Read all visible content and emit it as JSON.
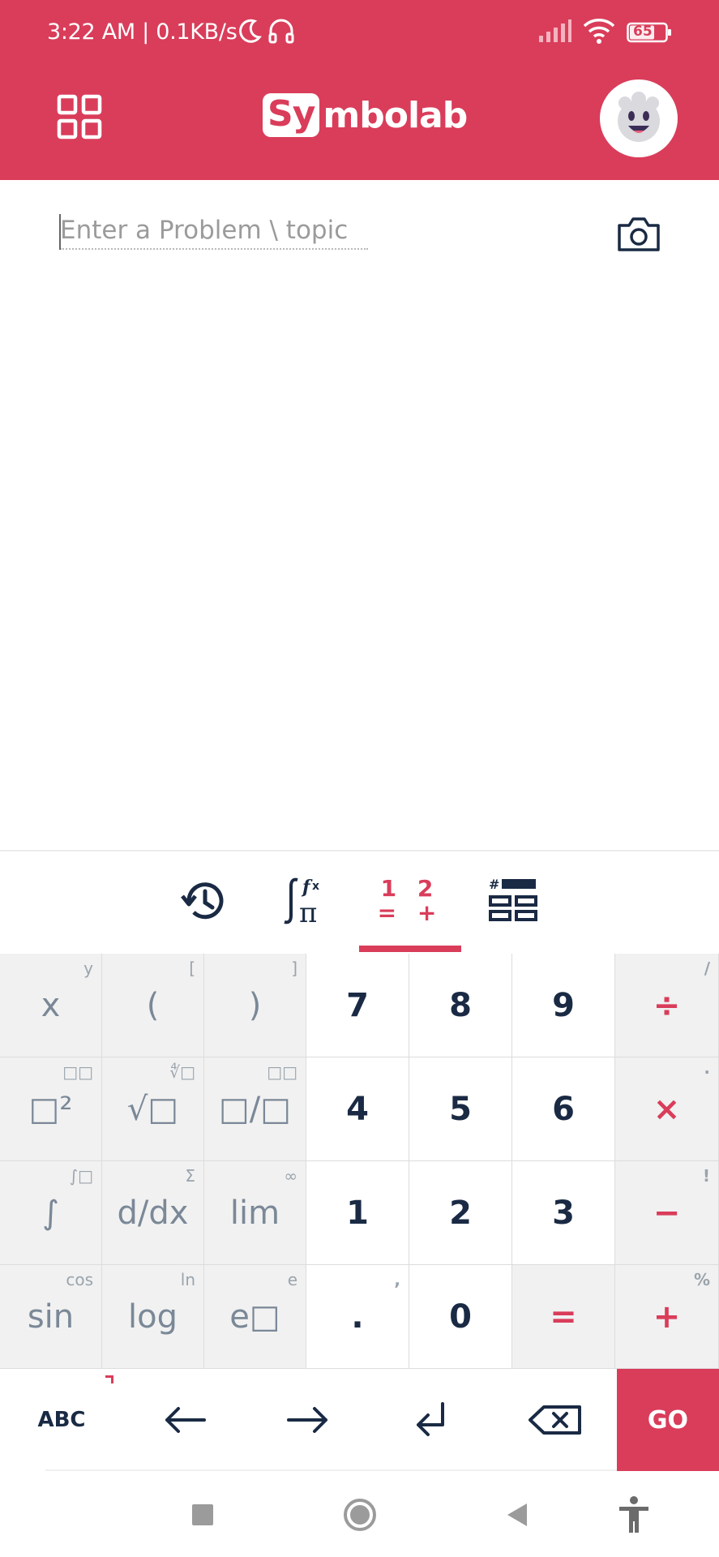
{
  "status_bar": {
    "time_speed": "3:22 AM | 0.1KB/s",
    "battery": "65"
  },
  "header": {
    "logo_box": "Sy",
    "logo_rest": "mbolab"
  },
  "input": {
    "placeholder": "Enter a Problem \\ topic",
    "value": ""
  },
  "tabs": {
    "numbers_top": "1 2",
    "numbers_bottom": "= +"
  },
  "keypad": {
    "rows": [
      [
        {
          "main": "x",
          "sub": "y"
        },
        {
          "main": "(",
          "sub": "["
        },
        {
          "main": ")",
          "sub": "]"
        },
        {
          "main": "7"
        },
        {
          "main": "8"
        },
        {
          "main": "9"
        },
        {
          "main": "÷",
          "sub": "/"
        }
      ],
      [
        {
          "main": "□²",
          "sub": "□□"
        },
        {
          "main": "√□",
          "sub": "∜□"
        },
        {
          "main": "□/□",
          "sub": "□□"
        },
        {
          "main": "4"
        },
        {
          "main": "5"
        },
        {
          "main": "6"
        },
        {
          "main": "×",
          "sub": "·"
        }
      ],
      [
        {
          "main": "∫",
          "sub": "∫□"
        },
        {
          "main": "d/dx",
          "sub": "Σ"
        },
        {
          "main": "lim",
          "sub": "∞"
        },
        {
          "main": "1"
        },
        {
          "main": "2"
        },
        {
          "main": "3"
        },
        {
          "main": "−",
          "sub": "!"
        }
      ],
      [
        {
          "main": "sin",
          "sub": "cos"
        },
        {
          "main": "log",
          "sub": "ln"
        },
        {
          "main": "e□",
          "sub": "e"
        },
        {
          "main": ".",
          "sub": ","
        },
        {
          "main": "0"
        },
        {
          "main": "="
        },
        {
          "main": "+",
          "sub": "%"
        }
      ]
    ]
  },
  "bottom_row": {
    "abc_label": "ABC",
    "go_label": "GO"
  },
  "colors": {
    "brand": "#d93d5a",
    "number_key_text": "#1a2a44",
    "function_key_text": "#7a8897"
  }
}
